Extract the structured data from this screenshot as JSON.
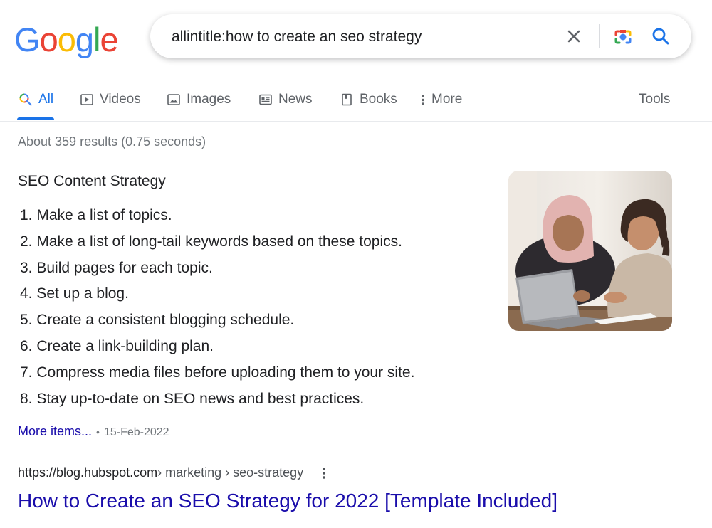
{
  "logo": {
    "text": "Google",
    "letters": [
      "G",
      "o",
      "o",
      "g",
      "l",
      "e"
    ],
    "colors": [
      "#4285F4",
      "#EA4335",
      "#FBBC05",
      "#4285F4",
      "#34A853",
      "#EA4335"
    ]
  },
  "search": {
    "query": "allintitle:how to create an seo strategy"
  },
  "tabs": [
    {
      "label": "All",
      "icon": "search-icon",
      "active": true
    },
    {
      "label": "Videos",
      "icon": "video-icon"
    },
    {
      "label": "Images",
      "icon": "image-icon"
    },
    {
      "label": "News",
      "icon": "news-icon"
    },
    {
      "label": "Books",
      "icon": "book-icon"
    },
    {
      "label": "More",
      "icon": "more-vert-icon"
    }
  ],
  "tools_label": "Tools",
  "stats": "About 359 results (0.75 seconds)",
  "snippet": {
    "title": "SEO Content Strategy",
    "items": [
      "1. Make a list of topics.",
      "2. Make a list of long-tail keywords based on these topics.",
      "3. Build pages for each topic.",
      "4. Set up a blog.",
      "5. Create a consistent blogging schedule.",
      "6. Create a link-building plan.",
      "7. Compress media files before uploading them to your site.",
      "8. Stay up-to-date on SEO news and best practices."
    ],
    "more_label": "More items...",
    "date": "15-Feb-2022"
  },
  "result": {
    "url_host": "https://blog.hubspot.com",
    "url_path": " › marketing › seo-strategy",
    "title": "How to Create an SEO Strategy for 2022 [Template Included]"
  },
  "colors": {
    "link": "#1a0dab",
    "accent": "#1a73e8",
    "muted": "#70757a"
  }
}
